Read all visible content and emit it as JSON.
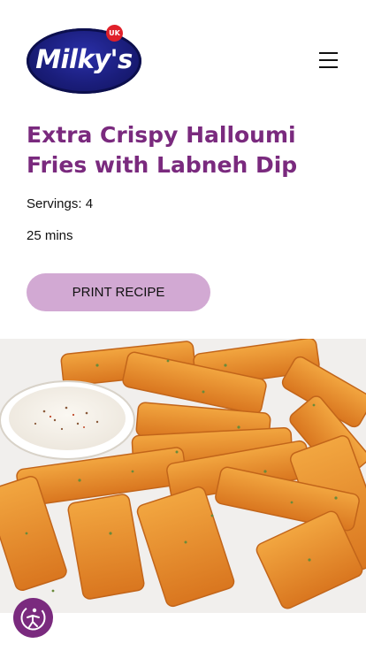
{
  "header": {
    "logo_text": "Milky's",
    "logo_badge": "UK",
    "menu_icon": "hamburger-menu-icon"
  },
  "recipe": {
    "title": "Extra Crispy Halloumi Fries with Labneh Dip",
    "servings": "Servings: 4",
    "time": "25 mins",
    "print_label": "PRINT RECIPE"
  },
  "accessibility": {
    "icon": "accessibility-icon"
  },
  "colors": {
    "title": "#7a2a7e",
    "print_button": "#d2a9d3",
    "accessibility_button": "#7a2a7e",
    "logo_oval": "#1a1d7a",
    "logo_badge": "#e0202a"
  }
}
